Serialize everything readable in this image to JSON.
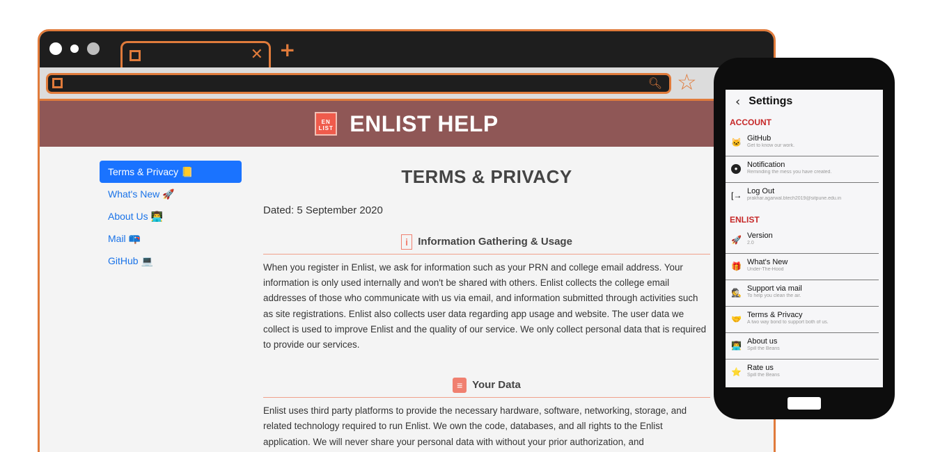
{
  "browser": {
    "tab_close_icon": "close-icon",
    "new_tab_icon": "plus-icon",
    "search_icon": "search-icon",
    "bookmark_icon": "star-icon",
    "accent_color": "#e07b3b"
  },
  "site": {
    "logo_text": "EN LIST",
    "title": "ENLIST HELP",
    "header_color": "#8f5756"
  },
  "nav": {
    "items": [
      {
        "label": "Terms & Privacy 📒"
      },
      {
        "label": "What's New 🚀"
      },
      {
        "label": "About Us 👨‍💻"
      },
      {
        "label": "Mail 📪"
      },
      {
        "label": "GitHub 💻"
      }
    ]
  },
  "content": {
    "title": "TERMS & PRIVACY",
    "dated": "Dated: 5 September 2020",
    "sections": [
      {
        "heading": "Information Gathering & Usage",
        "icon": "info-icon",
        "text": "When you register in Enlist, we ask for information such as your PRN and college email address. Your information is only used internally and won't be shared with others. Enlist collects the college email addresses of those who communicate with us via email, and information submitted through activities such as site registrations. Enlist also collects user data regarding app usage and website. The user data we collect is used to improve Enlist and the quality of our service. We only collect personal data that is required to provide our services."
      },
      {
        "heading": "Your Data",
        "icon": "database-icon",
        "text": "Enlist uses third party platforms to provide the necessary hardware, software, networking, storage, and related technology required to run Enlist. We own the code, databases, and all rights to the Enlist application. We will never share your personal data with without your prior authorization, and"
      }
    ]
  },
  "phone": {
    "title": "Settings",
    "sections": [
      {
        "label": "ACCOUNT",
        "items": [
          {
            "name": "GitHub",
            "sub": "Get to know our work.",
            "icon": "🐱"
          },
          {
            "name": "Notification",
            "sub": "Reminding the mess you have created.",
            "icon": "●"
          },
          {
            "name": "Log Out",
            "sub": "prakhar.agarwal.btech2019@sitpune.edu.in",
            "icon": "[→"
          }
        ]
      },
      {
        "label": "ENLIST",
        "items": [
          {
            "name": "Version",
            "sub": "2.0",
            "icon": "🚀"
          },
          {
            "name": "What's New",
            "sub": "Under-The-Hood",
            "icon": "🎁"
          },
          {
            "name": "Support via mail",
            "sub": "To help you clean the air.",
            "icon": "🕵"
          },
          {
            "name": "Terms & Privacy",
            "sub": "A two way bond to support both of us.",
            "icon": "🤝"
          },
          {
            "name": "About us",
            "sub": "Spill the Beans",
            "icon": "👨‍💻"
          },
          {
            "name": "Rate us",
            "sub": "Spill the Beans",
            "icon": "⭐"
          }
        ]
      }
    ]
  }
}
